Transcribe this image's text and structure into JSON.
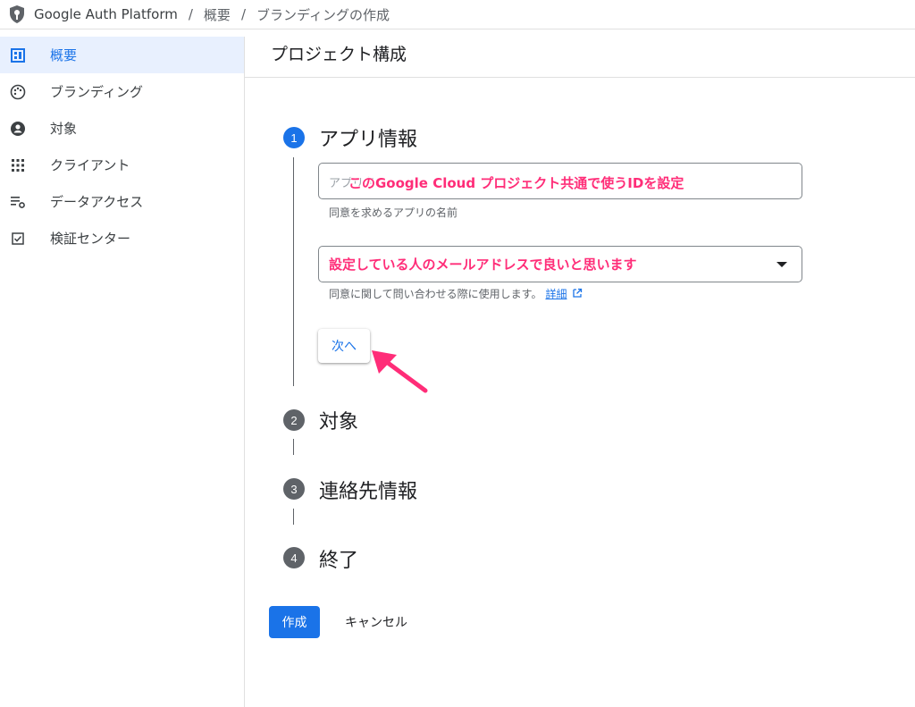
{
  "breadcrumb": {
    "items": [
      "Google Auth Platform",
      "概要",
      "ブランディングの作成"
    ],
    "separator": "/"
  },
  "sidebar": {
    "items": [
      {
        "label": "概要",
        "icon": "dashboard-icon",
        "active": true
      },
      {
        "label": "ブランディング",
        "icon": "palette-icon",
        "active": false
      },
      {
        "label": "対象",
        "icon": "account-circle-icon",
        "active": false
      },
      {
        "label": "クライアント",
        "icon": "grid-icon",
        "active": false
      },
      {
        "label": "データアクセス",
        "icon": "list-settings-icon",
        "active": false
      },
      {
        "label": "検証センター",
        "icon": "check-box-icon",
        "active": false
      }
    ]
  },
  "main": {
    "title": "プロジェクト構成",
    "steps": [
      {
        "number": "1",
        "title": "アプリ情報",
        "active": true
      },
      {
        "number": "2",
        "title": "対象",
        "active": false
      },
      {
        "number": "3",
        "title": "連絡先情報",
        "active": false
      },
      {
        "number": "4",
        "title": "終了",
        "active": false
      }
    ],
    "app_name": {
      "placeholder": "アプリ名",
      "annotation": "このGoogle Cloud プロジェクト共通で使うIDを設定",
      "hint": "同意を求めるアプリの名前"
    },
    "support_email": {
      "annotation": "設定している人のメールアドレスで良いと思います",
      "hint": "同意に関して問い合わせる際に使用します。",
      "link": "詳細"
    },
    "next_label": "次へ",
    "create_label": "作成",
    "cancel_label": "キャンセル"
  },
  "colors": {
    "accent": "#1a73e8",
    "annotation": "#ff2d78",
    "active_bg": "#e8f0fe"
  }
}
